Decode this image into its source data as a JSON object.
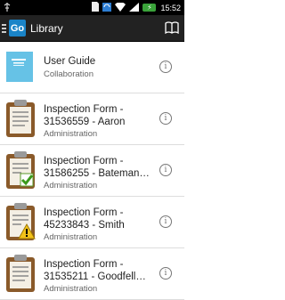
{
  "status_bar": {
    "time": "15:52",
    "icons": [
      "usb-icon",
      "sd-card-icon",
      "sync-icon",
      "wifi-signal-icon",
      "cell-signal-icon",
      "battery-icon"
    ]
  },
  "app_bar": {
    "logo_text": "Go",
    "title": "Library",
    "action_icon": "book-icon"
  },
  "items": [
    {
      "title": "User Guide",
      "title_line2": "",
      "subtitle": "Collaboration",
      "icon": "document-thumbnail-icon"
    },
    {
      "title": "Inspection Form -",
      "title_line2": "31536559 - Aaron",
      "subtitle": "Administration",
      "icon": "clipboard-icon"
    },
    {
      "title": "Inspection Form -",
      "title_line2": "31586255 - Bateman…",
      "subtitle": "Administration",
      "icon": "clipboard-check-icon"
    },
    {
      "title": "Inspection Form -",
      "title_line2": "45233843 - Smith",
      "subtitle": "Administration",
      "icon": "clipboard-warning-icon"
    },
    {
      "title": "Inspection Form -",
      "title_line2": "31535211 - Goodfell…",
      "subtitle": "Administration",
      "icon": "clipboard-icon"
    }
  ],
  "colors": {
    "app_bar": "#222222",
    "logo": "#1a84c8",
    "battery": "#3aa33a"
  }
}
